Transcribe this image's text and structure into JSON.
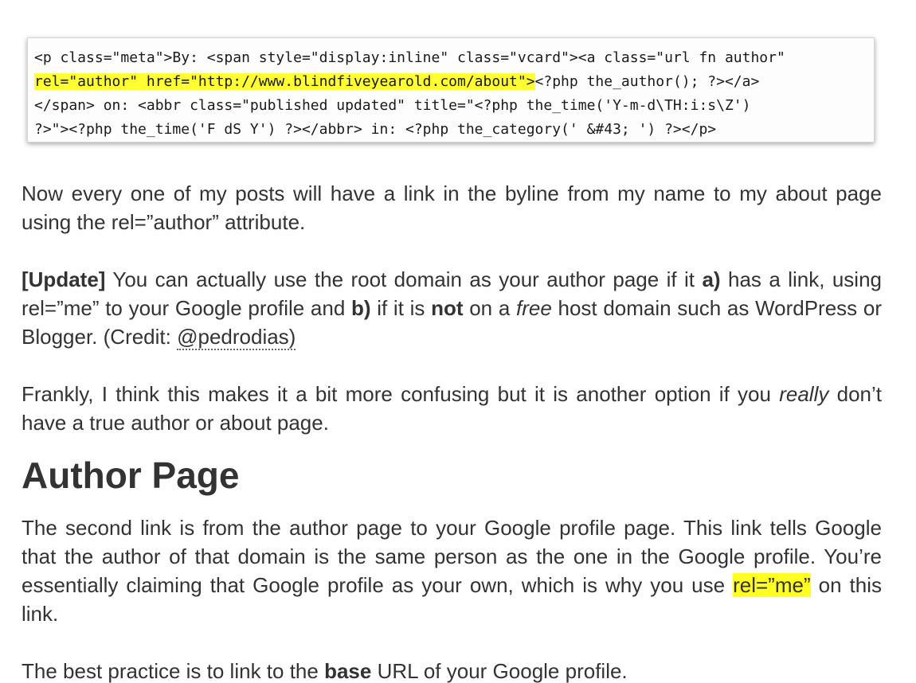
{
  "code_screenshot": {
    "line1": "<p class=\"meta\">By: <span style=\"display:inline\" class=\"vcard\"><a class=\"url fn author\"",
    "line2_highlight": "rel=\"author\" href=\"http://www.blindfiveyearold.com/about\">",
    "line2_rest": "<?php the_author(); ?></a>",
    "line3": "</span> on: <abbr class=\"published updated\" title=\"<?php the_time('Y-m-d\\TH:i:s\\Z')",
    "line4": "?>\"><?php the_time('F dS Y') ?></abbr> in: <?php the_category(' &#43; ') ?></p>"
  },
  "para1": {
    "text": "Now every one of my posts will have a link in the byline from my name to my about page using the rel=”author” attribute."
  },
  "para2": {
    "update_label": "[Update]",
    "t1": " You can actually use the root domain as your author page if it ",
    "a_label": "a)",
    "t2": " has a link, using rel=”me” to your Google profile and ",
    "b_label": "b)",
    "t3": " if it is ",
    "not_word": "not",
    "t4": " on a ",
    "free_word": "free",
    "t5": " host domain such as WordPress or Blogger. (Credit: ",
    "credit_link": "@pedrodias)"
  },
  "para3": {
    "t1": "Frankly, I think this makes it a bit more confusing but it is another option if you ",
    "really_word": "really",
    "t2": " don’t have a true author or about page."
  },
  "heading": "Author Page",
  "para4": {
    "t1": "The second link is from the author page to your Google profile page. This link tells Google that the author of that domain is the same person as the one in the Google profile. You’re essentially claiming that Google profile as your own, which is why you use ",
    "highlight": "rel=”me”",
    "t2": " on this link."
  },
  "para5": {
    "t1": "The best practice is to link to the ",
    "base_word": "base",
    "t2": " URL of your Google profile."
  }
}
